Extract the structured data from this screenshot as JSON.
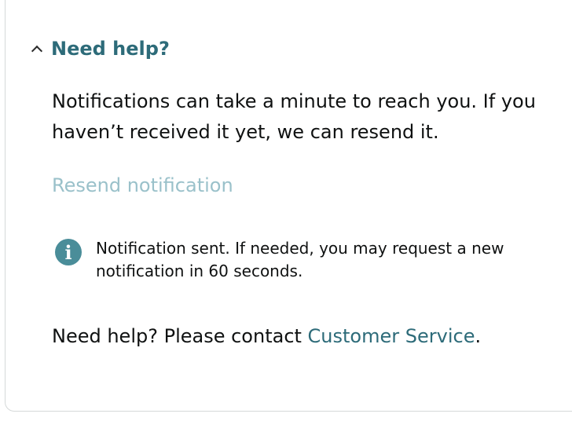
{
  "help": {
    "title": "Need help?",
    "description": "Notifications can take a minute to reach you. If you haven’t received it yet, we can resend it.",
    "resend_label": "Resend notification"
  },
  "info": {
    "icon": "info-icon",
    "message": "Notification sent. If needed, you may request a new notification in 60 seconds."
  },
  "contact": {
    "prefix": "Need help? Please contact ",
    "link_label": "Customer Service",
    "suffix": "."
  },
  "colors": {
    "link": "#2d6b79",
    "disabled_link": "#9ac1ca",
    "info_icon": "#4a8d99",
    "text": "#0f1111"
  }
}
